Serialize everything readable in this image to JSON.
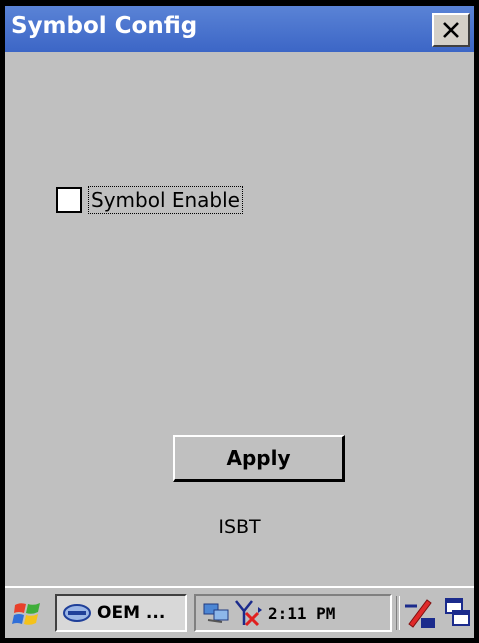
{
  "window": {
    "title": "Symbol Config",
    "close_glyph": "✕"
  },
  "form": {
    "checkbox_label": "Symbol Enable",
    "checkbox_checked": false,
    "apply_label": "Apply",
    "footer_text": "ISBT"
  },
  "taskbar": {
    "start_icon": "windows-flag-icon",
    "task_label": "OEM ...",
    "tray_time": "2:11 PM",
    "icons": [
      "network-icon",
      "antenna-disabled-icon",
      "input-panel-icon",
      "task-switch-icon"
    ]
  },
  "colors": {
    "titlebar": "#4a75d0",
    "window_bg": "#c0c0c0",
    "text": "#000000"
  }
}
